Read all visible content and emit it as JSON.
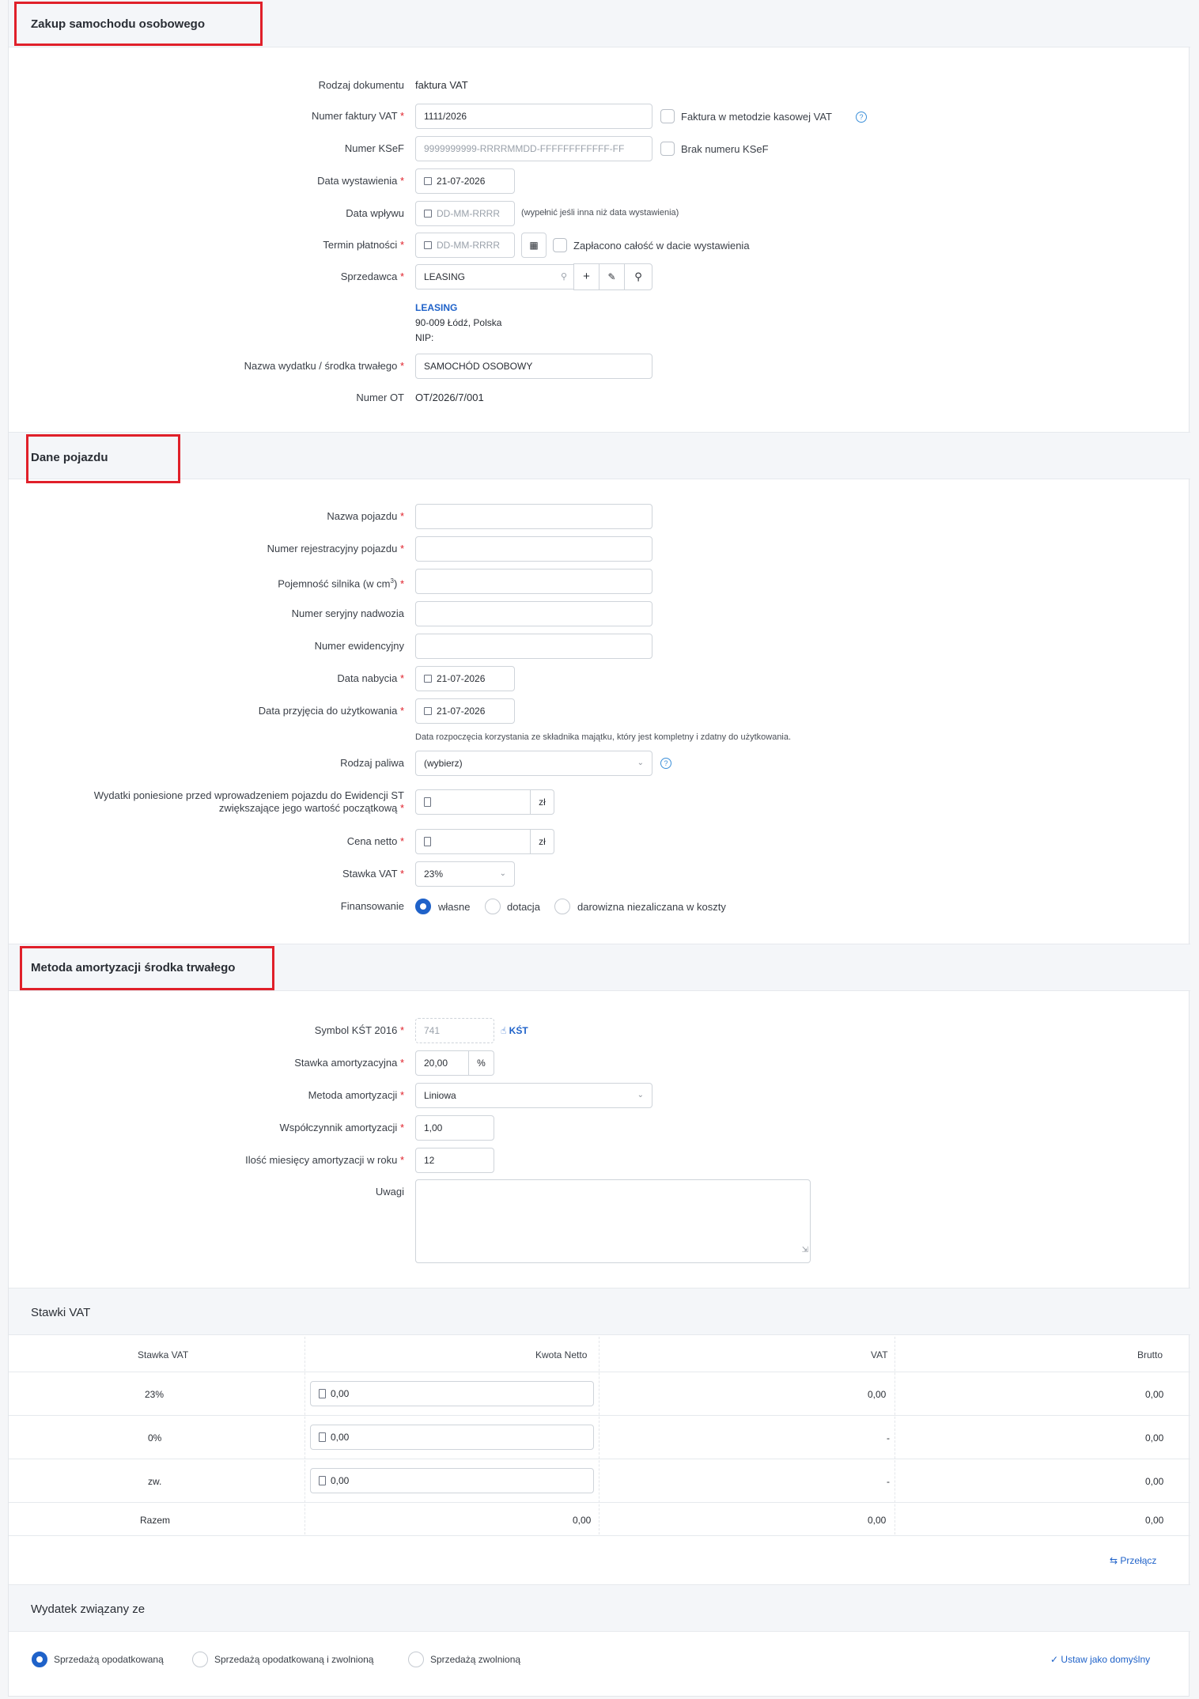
{
  "section1": {
    "title": "Zakup samochodu osobowego",
    "doc_type_label": "Rodzaj dokumentu",
    "doc_type_value": "faktura VAT",
    "invoice_no_label": "Numer faktury VAT",
    "invoice_no_value": "1111/2026",
    "cash_method_label": "Faktura w metodzie kasowej VAT",
    "ksef_label": "Numer KSeF",
    "ksef_placeholder": "9999999999-RRRRMMDD-FFFFFFFFFFFF-FF",
    "no_ksef_label": "Brak numeru KSeF",
    "issue_date_label": "Data wystawienia",
    "issue_date_value": "21-07-2026",
    "receipt_date_label": "Data wpływu",
    "date_placeholder": "DD-MM-RRRR",
    "receipt_hint": "(wypełnić jeśli inna niż data wystawienia)",
    "due_date_label": "Termin płatności",
    "paid_label": "Zapłacono całość w dacie wystawienia",
    "seller_label": "Sprzedawca",
    "seller_value": "LEASING",
    "seller_name": "LEASING",
    "seller_address": "90-009 Łódź, Polska",
    "seller_nip": "NIP:",
    "expense_name_label": "Nazwa wydatku / środka trwałego",
    "expense_name_value": "SAMOCHÓD OSOBOWY",
    "ot_label": "Numer OT",
    "ot_value": "OT/2026/7/001"
  },
  "section2": {
    "title": "Dane pojazdu",
    "vehicle_name_label": "Nazwa pojazdu",
    "reg_no_label": "Numer rejestracyjny pojazdu",
    "engine_label": "Pojemność silnika (w cm",
    "engine_sup": "3",
    "engine_label_end": ")",
    "vin_label": "Numer seryjny nadwozia",
    "evid_label": "Numer ewidencyjny",
    "acq_date_label": "Data nabycia",
    "acq_date_value": "21-07-2026",
    "use_date_label": "Data przyjęcia do użytkowania",
    "use_date_value": "21-07-2026",
    "use_date_hint": "Data rozpoczęcia korzystania ze składnika majątku, który jest kompletny i zdatny do użytkowania.",
    "fuel_label": "Rodzaj paliwa",
    "fuel_value": "(wybierz)",
    "expenses_label_1": "Wydatki poniesione przed wprowadzeniem pojazdu do Ewidencji ST",
    "expenses_label_2": "zwiększające jego wartość początkową",
    "currency": "zł",
    "net_price_label": "Cena netto",
    "vat_rate_label": "Stawka VAT",
    "vat_rate_value": "23%",
    "financing_label": "Finansowanie",
    "financing_options": [
      "własne",
      "dotacja",
      "darowizna niezaliczana w koszty"
    ],
    "financing_selected": "własne"
  },
  "section3": {
    "title": "Metoda amortyzacji środka trwałego",
    "kst_label": "Symbol KŚT 2016",
    "kst_value": "741",
    "kst_link": "KŚT",
    "rate_label": "Stawka amortyzacyjna",
    "rate_value": "20,00",
    "rate_unit": "%",
    "method_label": "Metoda amortyzacji",
    "method_value": "Liniowa",
    "coef_label": "Współczynnik amortyzacji",
    "coef_value": "1,00",
    "months_label": "Ilość miesięcy amortyzacji w roku",
    "months_value": "12",
    "notes_label": "Uwagi"
  },
  "vat_table": {
    "title": "Stawki VAT",
    "headers": [
      "Stawka VAT",
      "Kwota Netto",
      "VAT",
      "Brutto"
    ],
    "rows": [
      {
        "rate": "23%",
        "net": "0,00",
        "vat": "0,00",
        "gross": "0,00"
      },
      {
        "rate": "0%",
        "net": "0,00",
        "vat": "-",
        "gross": "0,00"
      },
      {
        "rate": "zw.",
        "net": "0,00",
        "vat": "-",
        "gross": "0,00"
      }
    ],
    "total": {
      "label": "Razem",
      "net": "0,00",
      "vat": "0,00",
      "gross": "0,00"
    },
    "switch_link": "Przełącz"
  },
  "section5": {
    "title": "Wydatek związany ze",
    "options": [
      "Sprzedażą opodatkowaną",
      "Sprzedażą opodatkowaną i zwolnioną",
      "Sprzedażą zwolnioną"
    ],
    "selected": "Sprzedażą opodatkowaną",
    "default_link": "Ustaw jako domyślny"
  },
  "colors": {
    "accent": "#1f62c9",
    "required": "#e0202a",
    "highlight_box": "#e0202a"
  }
}
